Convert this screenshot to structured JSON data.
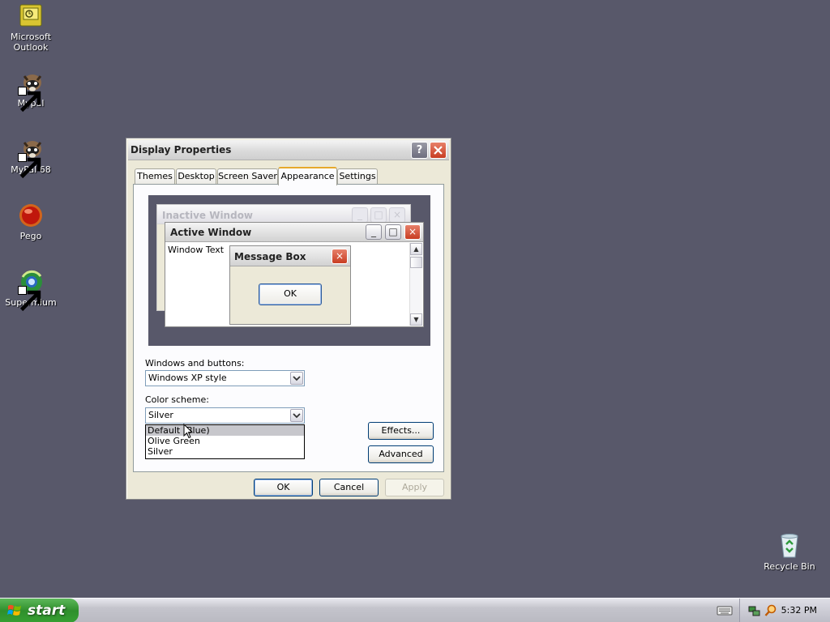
{
  "desktop": {
    "icons": [
      {
        "label": "Microsoft Outlook",
        "icon": "outlook-icon"
      },
      {
        "label": "Mypal",
        "icon": "raccoon-icon"
      },
      {
        "label": "MyPal 68",
        "icon": "raccoon-icon"
      },
      {
        "label": "Pego",
        "icon": "red-orb-icon"
      },
      {
        "label": "Supermium",
        "icon": "globe-icon"
      },
      {
        "label": "Recycle Bin",
        "icon": "recycle-bin-icon"
      }
    ]
  },
  "dialog": {
    "title": "Display Properties",
    "help": "?",
    "tabs": [
      "Themes",
      "Desktop",
      "Screen Saver",
      "Appearance",
      "Settings"
    ],
    "active_tab": "Appearance",
    "preview": {
      "inactive_title": "Inactive Window",
      "active_title": "Active Window",
      "window_text": "Window Text",
      "message_title": "Message Box",
      "message_ok": "OK"
    },
    "windows_buttons_label": "Windows and buttons:",
    "windows_buttons_value": "Windows XP style",
    "color_scheme_label": "Color scheme:",
    "color_scheme_value": "Silver",
    "color_scheme_options": [
      "Default (Blue)",
      "Olive Green",
      "Silver"
    ],
    "color_scheme_highlighted": "Default (Blue)",
    "effects_button": "Effects...",
    "advanced_button": "Advanced",
    "ok_button": "OK",
    "cancel_button": "Cancel",
    "apply_button": "Apply"
  },
  "taskbar": {
    "start_label": "start",
    "clock": "5:32 PM"
  },
  "colors": {
    "desktop": "#58586a",
    "dialog_face": "#ece9d8",
    "start_green": "#2f8f2c",
    "close_red": "#c83d22",
    "tab_highlight": "#e6a92c"
  }
}
